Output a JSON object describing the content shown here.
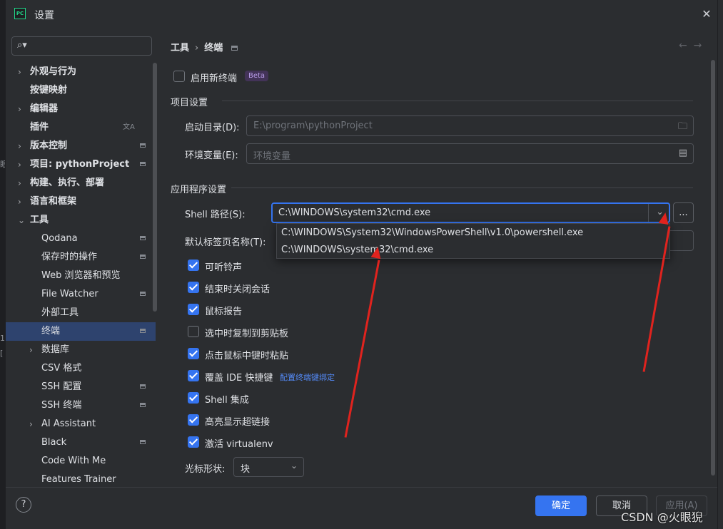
{
  "window": {
    "title": "设置",
    "app_logo": "PC"
  },
  "search": {
    "placeholder": ""
  },
  "tree": [
    {
      "label": "外观与行为",
      "bold": true,
      "arrow": true
    },
    {
      "label": "按键映射",
      "bold": true
    },
    {
      "label": "编辑器",
      "bold": true,
      "arrow": true
    },
    {
      "label": "插件",
      "bold": true
    },
    {
      "label": "版本控制",
      "bold": true,
      "arrow": true
    },
    {
      "label": "项目: pythonProject",
      "bold": true,
      "arrow": true
    },
    {
      "label": "构建、执行、部署",
      "bold": true,
      "arrow": true
    },
    {
      "label": "语言和框架",
      "bold": true,
      "arrow": true
    },
    {
      "label": "工具",
      "bold": true,
      "arrow": true,
      "expanded": true
    },
    {
      "label": "Qodana"
    },
    {
      "label": "保存时的操作"
    },
    {
      "label": "Web 浏览器和预览"
    },
    {
      "label": "File Watcher"
    },
    {
      "label": "外部工具"
    },
    {
      "label": "终端",
      "selected": true
    },
    {
      "label": "数据库",
      "arrow": true
    },
    {
      "label": "CSV 格式"
    },
    {
      "label": "SSH 配置"
    },
    {
      "label": "SSH 终端"
    },
    {
      "label": "AI Assistant",
      "arrow": true
    },
    {
      "label": "Black"
    },
    {
      "label": "Code With Me"
    },
    {
      "label": "Features Trainer"
    }
  ],
  "breadcrumb": {
    "parent": "工具",
    "current": "终端",
    "sep": "›"
  },
  "new_terminal": {
    "label": "启用新终端",
    "badge": "Beta",
    "checked": false
  },
  "project_settings": {
    "heading": "项目设置",
    "start_dir_label": "启动目录(D):",
    "start_dir_value": "E:\\program\\pythonProject",
    "env_label": "环境变量(E):",
    "env_placeholder": "环境变量"
  },
  "app_settings": {
    "heading": "应用程序设置",
    "shell_label": "Shell 路径(S):",
    "shell_value": "C:\\WINDOWS\\system32\\cmd.exe",
    "more_button": "...",
    "tab_name_label": "默认标签页名称(T):",
    "dropdown_options": [
      "C:\\WINDOWS\\System32\\WindowsPowerShell\\v1.0\\powershell.exe",
      "C:\\WINDOWS\\system32\\cmd.exe"
    ]
  },
  "options": [
    {
      "label": "可听铃声",
      "checked": true
    },
    {
      "label": "结束时关闭会话",
      "checked": true
    },
    {
      "label": "鼠标报告",
      "checked": true
    },
    {
      "label": "选中时复制到剪贴板",
      "checked": false
    },
    {
      "label": "点击鼠标中键时粘贴",
      "checked": true
    },
    {
      "label": "覆盖 IDE 快捷键",
      "checked": true,
      "link": "配置终端键绑定"
    },
    {
      "label": "Shell 集成",
      "checked": true
    },
    {
      "label": "高亮显示超链接",
      "checked": true
    },
    {
      "label": "激活 virtualenv",
      "checked": true
    }
  ],
  "cursor_shape": {
    "label": "光标形状:",
    "value": "块"
  },
  "footer": {
    "ok": "确定",
    "cancel": "取消",
    "apply": "应用(A)",
    "help": "?"
  },
  "watermark": "CSDN @火眼猊",
  "colors": {
    "accent": "#3574f0",
    "annotation": "#e0231e",
    "background": "#2b2d30"
  }
}
